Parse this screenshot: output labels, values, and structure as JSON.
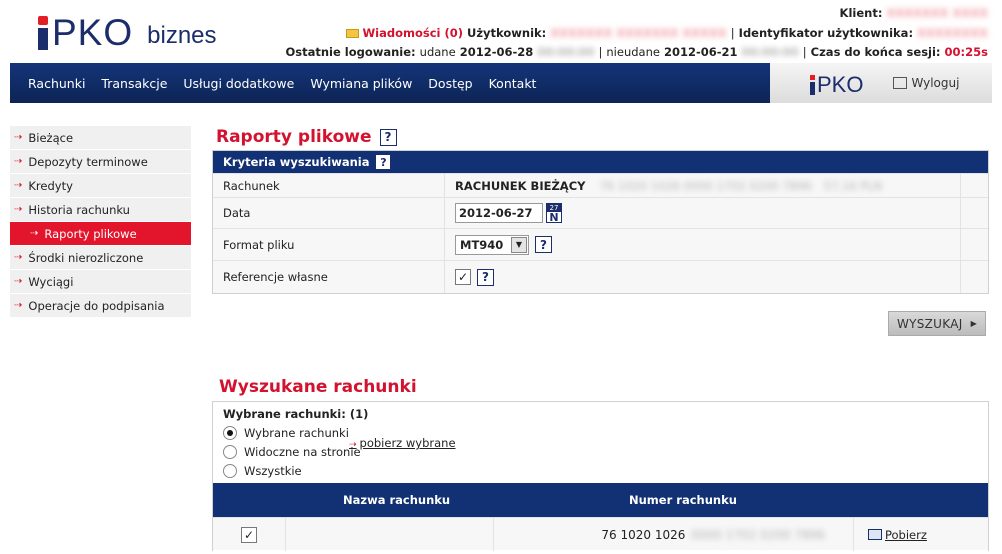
{
  "header": {
    "logo_brand": "PKO",
    "logo_sub": "biznes",
    "client_label": "Klient:",
    "client_value": "XXXXXXX XXXX",
    "messages": "Wiadomości (0)",
    "user_label": "Użytkownik:",
    "user_value": "XXXXXXX XXXXXXX XXXXX",
    "user_id_label": "Identyfikator użytkownika:",
    "user_id_value": "XXXXXXXX",
    "last_login_label": "Ostatnie logowanie:",
    "success_label": "udane",
    "success_date": "2012-06-28",
    "success_time": "00:00:00",
    "fail_label": "nieudane",
    "fail_date": "2012-06-21",
    "fail_time": "00:00:00",
    "session_label": "Czas do końca sesji:",
    "session_value": "00:25s"
  },
  "nav": {
    "items": [
      "Rachunki",
      "Transakcje",
      "Usługi dodatkowe",
      "Wymiana plików",
      "Dostęp",
      "Kontakt"
    ],
    "logo_small": "PKO",
    "logout": "Wyloguj"
  },
  "sidebar": {
    "items": [
      "Bieżące",
      "Depozyty terminowe",
      "Kredyty",
      "Historia rachunku",
      "Raporty plikowe",
      "Środki nierozliczone",
      "Wyciągi",
      "Operacje do podpisania"
    ]
  },
  "page": {
    "title": "Raporty plikowe",
    "help": "?"
  },
  "criteria": {
    "header": "Kryteria wyszukiwania",
    "account_label": "Rachunek",
    "account_name": "RACHUNEK BIEŻĄCY",
    "account_number": "76 1020 1026 0000 1702 0200 7896",
    "account_balance": "57,16 PLN",
    "date_label": "Data",
    "date_value": "2012-06-27",
    "calendar_top": "27",
    "calendar_letter": "N",
    "format_label": "Format pliku",
    "format_value": "MT940",
    "ref_label": "Referencje własne",
    "ref_checked": "✓"
  },
  "search_button": "WYSZUKAJ",
  "results": {
    "title": "Wyszukane rachunki",
    "selected_title": "Wybrane rachunki: (1)",
    "radio_options": [
      "Wybrane rachunki",
      "Widoczne na stronie",
      "Wszystkie"
    ],
    "get_selected": "pobierz wybrane",
    "col_name": "Nazwa rachunku",
    "col_number": "Numer rachunku",
    "row_check": "✓",
    "row_number_visible": "76 1020 1026",
    "row_number_hidden": "0000 1702 0200 7896",
    "row_action": "Pobierz"
  }
}
